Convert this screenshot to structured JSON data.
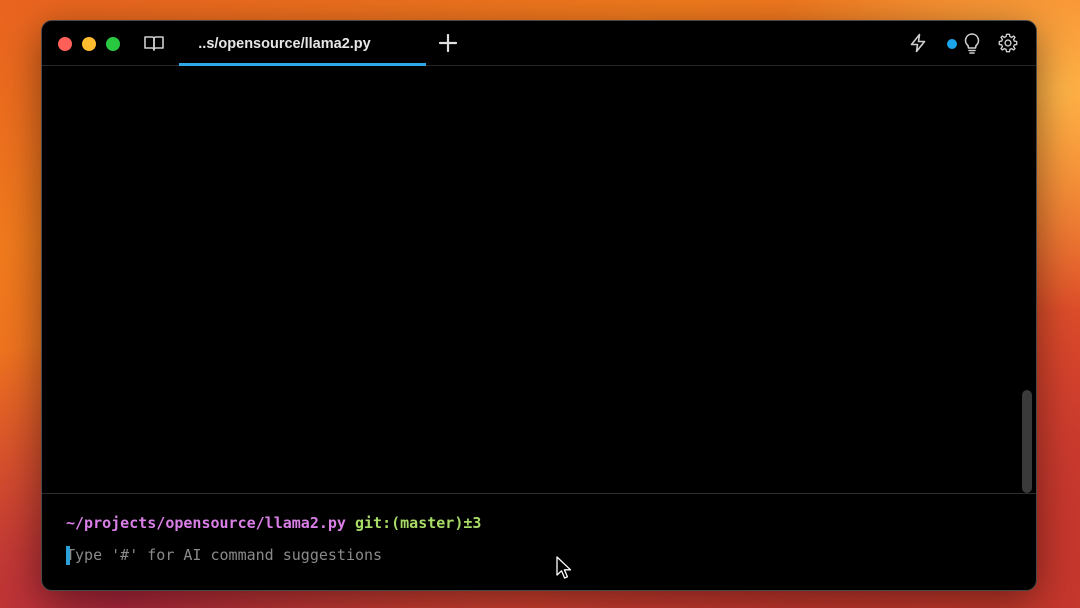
{
  "window": {
    "tab_title": "..s/opensource/llama2.py",
    "accent_color": "#2ea8e6"
  },
  "toolbar": {
    "left_icons": [
      "close-icon",
      "minimize-icon",
      "zoom-icon",
      "book-icon"
    ],
    "right_icons": [
      "bolt-icon",
      "status-dot",
      "lightbulb-icon",
      "gear-icon"
    ],
    "new_tab_icon": "plus-icon"
  },
  "prompt": {
    "path": "~/projects/opensource/llama2.py",
    "git": "git:(master)±3",
    "path_color": "#d97fe6",
    "git_color": "#a8dc66"
  },
  "input": {
    "value": "",
    "placeholder": "Type '#' for AI command suggestions"
  }
}
